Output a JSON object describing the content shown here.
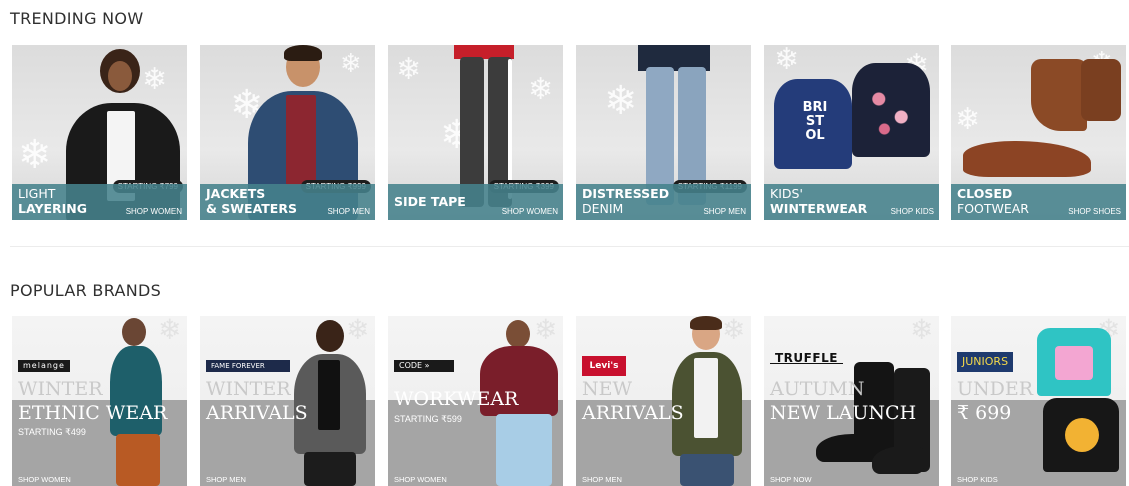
{
  "sections": {
    "trending_title": "TRENDING NOW",
    "brands_title": "POPULAR BRANDS"
  },
  "trending": [
    {
      "line1": "LIGHT",
      "line2": "LAYERING",
      "starting": "STARTING ₹799",
      "shop": "SHOP WOMEN"
    },
    {
      "line1": "JACKETS",
      "line2": "& SWEATERS",
      "starting": "STARTING ₹999",
      "shop": "SHOP MEN"
    },
    {
      "line1": "",
      "line2": "SIDE TAPE",
      "starting": "STARTING ₹399",
      "shop": "SHOP WOMEN"
    },
    {
      "line1": "DISTRESSED",
      "line2": "DENIM",
      "starting": "STARTING ₹1199",
      "shop": "SHOP MEN"
    },
    {
      "line1": "KIDS'",
      "line2": "WINTERWEAR",
      "starting": "",
      "shop": "SHOP KIDS"
    },
    {
      "line1": "CLOSED",
      "line2": "FOOTWEAR",
      "starting": "",
      "shop": "SHOP SHOES"
    }
  ],
  "brands": [
    {
      "logo": "melange",
      "line1": "WINTER",
      "line2": "ETHNIC WEAR",
      "line3": "STARTING ₹499",
      "shop": "SHOP WOMEN"
    },
    {
      "logo": "FAME FOREVER",
      "line1": "WINTER",
      "line2": "ARRIVALS",
      "line3": "",
      "shop": "SHOP MEN"
    },
    {
      "logo": "CODE »",
      "line1": "",
      "line2": "WORKWEAR",
      "line3": "STARTING ₹599",
      "shop": "SHOP WOMEN"
    },
    {
      "logo": "Levi's",
      "line1": "NEW",
      "line2": "ARRIVALS",
      "line3": "",
      "shop": "SHOP MEN"
    },
    {
      "logo": "TRUFFLE",
      "line1": "AUTUMN",
      "line2": "NEW LAUNCH",
      "line3": "",
      "shop": "SHOP NOW"
    },
    {
      "logo": "JUNIORS",
      "line1": "UNDER",
      "line2": "₹ 699",
      "line3": "",
      "shop": "SHOP KIDS"
    }
  ],
  "colors": {
    "caption_teal": "#46828c",
    "brand_band_gray": "#a5a5a5",
    "levis_red": "#c8102e",
    "juniors_navy": "#1e3a6e"
  }
}
